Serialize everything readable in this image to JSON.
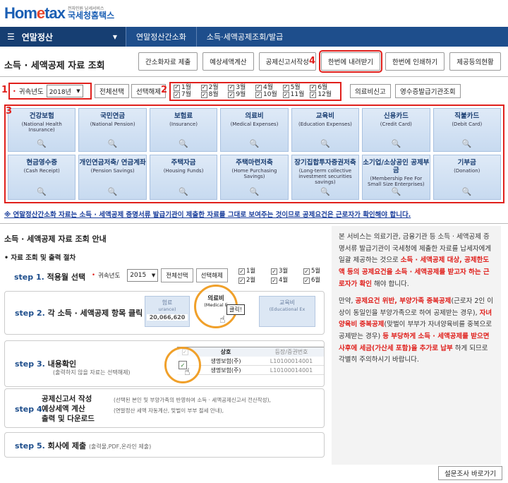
{
  "logo": {
    "brand": "Hometax",
    "sub": "전자민원 납세서비스",
    "name": "국세청홈택스"
  },
  "nav": {
    "menu": "연말정산",
    "crumb1": "연말정산간소화",
    "crumb2": "소득·세액공제조회/발급"
  },
  "page_title": "소득 · 세액공제 자료 조회",
  "top_buttons": [
    "간소화자료 제출",
    "예상세액계산",
    "공제신고서작성",
    "한번에 내려받기",
    "한번에 인쇄하기",
    "제공등의현황"
  ],
  "markers": {
    "m1": "1",
    "m2": "2",
    "m3": "3",
    "m4": "4"
  },
  "filter": {
    "year_label": "귀속년도",
    "year_value": "2018년",
    "select_all": "전체선택",
    "deselect": "선택해제",
    "months": [
      "1월",
      "2월",
      "3월",
      "4월",
      "5월",
      "6월",
      "7월",
      "8월",
      "9월",
      "10월",
      "11월",
      "12월"
    ],
    "medical": "의료비신고",
    "receipt": "영수증발급기관조회"
  },
  "tiles": [
    {
      "ko": "건강보험",
      "en": "(National Health Insurance)"
    },
    {
      "ko": "국민연금",
      "en": "(National Pension)"
    },
    {
      "ko": "보험료",
      "en": "(Insurance)"
    },
    {
      "ko": "의료비",
      "en": "(Medical Expenses)"
    },
    {
      "ko": "교육비",
      "en": "(Education Expenses)"
    },
    {
      "ko": "신용카드",
      "en": "(Credit Card)"
    },
    {
      "ko": "직불카드",
      "en": "(Debit Card)"
    },
    {
      "ko": "현금영수증",
      "en": "(Cash Receipt)"
    },
    {
      "ko": "개인연금저축/ 연금계좌",
      "en": "(Pension Savings)"
    },
    {
      "ko": "주택자금",
      "en": "(Housing Funds)"
    },
    {
      "ko": "주택마련저축",
      "en": "(Home Purchasing Savings)"
    },
    {
      "ko": "장기집합투자증권저축",
      "en": "(Long-term collective investment securities savings)"
    },
    {
      "ko": "소기업/소상공인 공제부금",
      "en": "(Membership Fee For Small Size Enterprises)"
    },
    {
      "ko": "기부금",
      "en": "(Donation)"
    }
  ],
  "notice": "※ 연말정산간소화 자료는 소득 · 세액공제 증명서류 발급기관이 제출한 자료를 그대로 보여주는 것이므로 공제요건은 근로자가 확인해야 합니다.",
  "guide": {
    "title": "소득 · 세액공제 자료 조회 안내",
    "proc": "• 자료 조회 및 출력 절차",
    "steps": [
      {
        "no": "step 1.",
        "title": "적용월 선택"
      },
      {
        "no": "step 2.",
        "title": "각 소득 · 세액공제 항목 클릭"
      },
      {
        "no": "step 3.",
        "title": "내용확인",
        "desc": "(출력하지 않을 자료는 선택해제)"
      },
      {
        "no": "step 4.",
        "title1": "공제신고서 작성",
        "title2": "예상세액 계산",
        "title3": "출력 및 다운로드",
        "desc1": "(선택된 본인 및 부양가족의 반영하여 소득 · 세액공제신고서 전산작성),",
        "desc2": "(연말정산 세액 자동계산, 맞벌이 부부 절세 안내),"
      },
      {
        "no": "step 5.",
        "title": "회사에 제출",
        "desc": "(출력물,PDF,온라인 제출)"
      }
    ],
    "s1": {
      "year_label": "귀속년도",
      "year": "2015",
      "select_all": "전체선택",
      "deselect": "선택해제",
      "m": [
        "1월",
        "2월",
        "3월",
        "4월",
        "5월",
        "6월"
      ]
    },
    "s2": {
      "left": "험료",
      "left_en": "urance)",
      "amount": "20,066,620",
      "center": "의료비",
      "center_en": "(Medical E",
      "click": "클릭!",
      "right": "교육비",
      "right_en": "(Educational Ex"
    },
    "s3": {
      "col1": "상호",
      "col2": "등장/증권번호",
      "r1a": "생명보험(주)",
      "r1b": "L10100014001",
      "r2a": "생명보험(주)",
      "r2b": "L10100014001"
    }
  },
  "side": {
    "p1a": "본 서비스는 의료기관, 금융기관 등 소득 · 세액공제 증명서류 발급기관이 국세청에 제출한 자료를 납세자에게 일괄 제공하는 것으로 ",
    "p1b": "소득 · 세액공제 대상, 공제한도액 등의 공제요건을 소득 · 세액공제를 받고자 하는 근로자가 확인",
    "p1c": " 해야 합니다.",
    "p2a": "만약, ",
    "p2b": "공제요건 위반, 부양가족 중복공제",
    "p2c": "(근로자 2인 이상이 동일인을 부양가족으로 하여 공제받는 경우), ",
    "p2d": "자녀양육비 중복공제",
    "p2e": "(맞벌이 부부가 자녀양육비를 중복으로 공제받는 경우) ",
    "p2f": "등 부당하게 소득 · 세액공제를 받으면 사후에 세금(가산세 포함)을 추가로 납부",
    "p2g": " 하게 되므로 각별히 주의하시기 바랍니다."
  },
  "survey": "설문조사 바로가기"
}
